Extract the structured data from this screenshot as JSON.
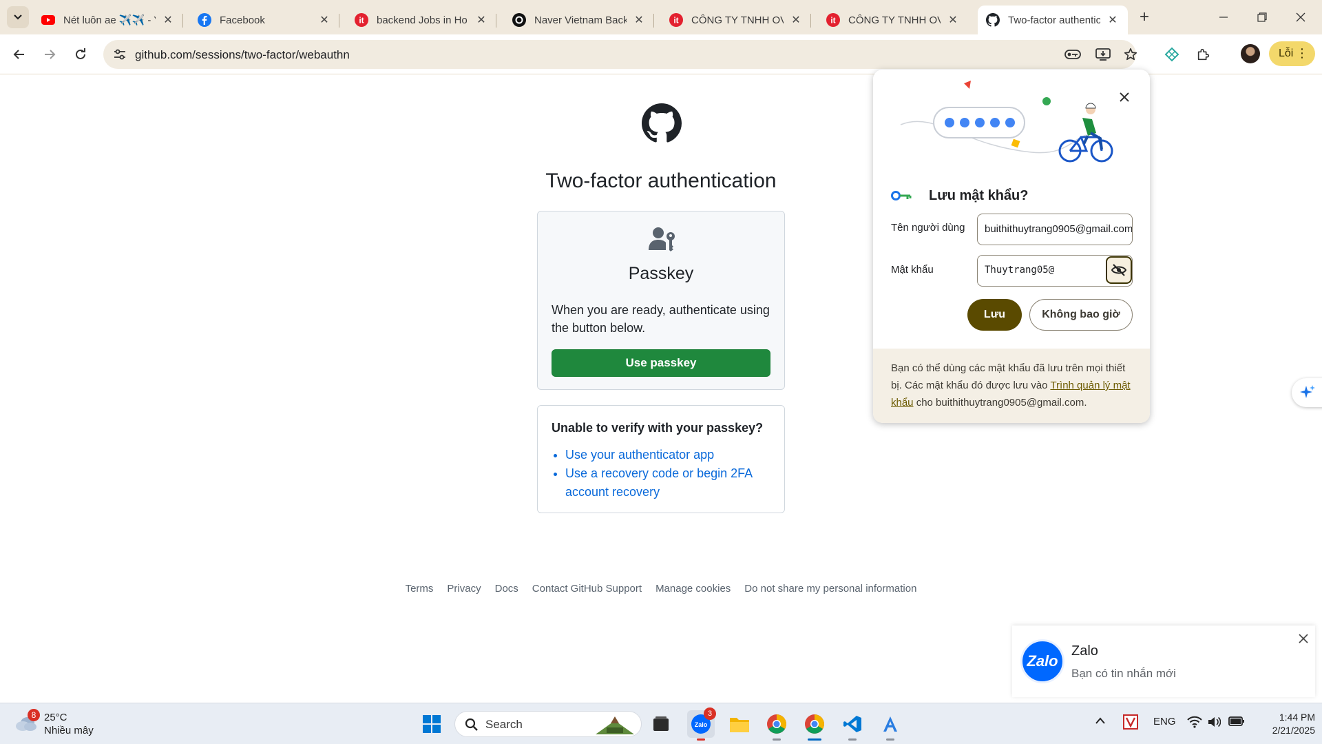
{
  "browser": {
    "tabs": [
      {
        "title": "Nét luôn ae ✈️✈️ - Y",
        "favicon": "youtube-icon",
        "active": false
      },
      {
        "title": "Facebook",
        "favicon": "facebook-icon",
        "active": false
      },
      {
        "title": "backend Jobs in Ho C",
        "favicon": "itviec-icon",
        "active": false
      },
      {
        "title": "Naver Vietnam Backe",
        "favicon": "threads-icon",
        "active": false
      },
      {
        "title": "CÔNG TY TNHH OVE",
        "favicon": "itviec-icon",
        "active": false
      },
      {
        "title": "CÔNG TY TNHH OVE",
        "favicon": "itviec-icon",
        "active": false
      },
      {
        "title": "Two-factor authentic",
        "favicon": "github-icon",
        "active": true
      }
    ],
    "url": "github.com/sessions/two-factor/webauthn",
    "profile_label": "Lỗi"
  },
  "page": {
    "heading": "Two-factor authentication",
    "passkey": {
      "title": "Passkey",
      "text": "When you are ready, authenticate using the button below.",
      "button": "Use passkey"
    },
    "fallback": {
      "title": "Unable to verify with your passkey?",
      "links": [
        "Use your authenticator app",
        "Use a recovery code or begin 2FA account recovery"
      ]
    },
    "footer_links": [
      "Terms",
      "Privacy",
      "Docs",
      "Contact GitHub Support",
      "Manage cookies",
      "Do not share my personal information"
    ]
  },
  "password_popup": {
    "title": "Lưu mật khẩu?",
    "username_label": "Tên người dùng",
    "username_value": "buithithuytrang0905@gmail.com",
    "password_label": "Mật khẩu",
    "password_value": "Thuytrang05@",
    "save_button": "Lưu",
    "never_button": "Không bao giờ",
    "footer_pre": "Bạn có thể dùng các mật khẩu đã lưu trên mọi thiết bị. Các mật khẩu đó được lưu vào ",
    "footer_link": "Trình quản lý mật khẩu",
    "footer_post": " cho buithithuytrang0905@gmail.com."
  },
  "notification": {
    "app": "Zalo",
    "message": "Bạn có tin nhắn mới",
    "logo_text": "Zalo"
  },
  "taskbar": {
    "weather_badge": "8",
    "temperature": "25°C",
    "weather_desc": "Nhiều mây",
    "search_placeholder": "Search",
    "zalo_badge": "3",
    "language": "ENG",
    "time": "1:44 PM",
    "date": "2/21/2025"
  },
  "colors": {
    "github_green": "#1f883d",
    "link_blue": "#0969da",
    "save_button": "#5a4a00",
    "tabstrip": "#f0e9dd"
  }
}
